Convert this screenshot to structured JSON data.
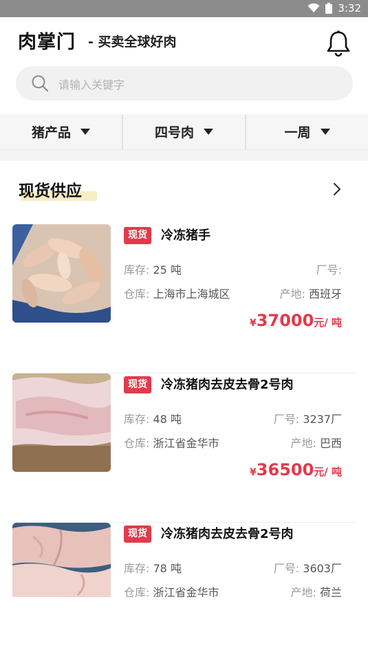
{
  "status": {
    "time": "3:32"
  },
  "header": {
    "title": "肉掌门",
    "subtitle": "- 买卖全球好肉"
  },
  "search": {
    "placeholder": "请输入关键字"
  },
  "filters": [
    {
      "label": "猪产品"
    },
    {
      "label": "四号肉"
    },
    {
      "label": "一周"
    }
  ],
  "section": {
    "title": "现货供应"
  },
  "products": [
    {
      "badge": "现货",
      "name": "冷冻猪手",
      "stock_label": "库存:",
      "stock": "25 吨",
      "factory_label": "厂号:",
      "factory": "",
      "warehouse_label": "仓库:",
      "warehouse": "上海市上海城区",
      "origin_label": "产地:",
      "origin": "西班牙",
      "price_symbol": "¥",
      "price": "37000",
      "price_unit": "元/ 吨"
    },
    {
      "badge": "现货",
      "name": "冷冻猪肉去皮去骨2号肉",
      "stock_label": "库存:",
      "stock": "48 吨",
      "factory_label": "厂号:",
      "factory": "3237厂",
      "warehouse_label": "仓库:",
      "warehouse": "浙江省金华市",
      "origin_label": "产地:",
      "origin": "巴西",
      "price_symbol": "¥",
      "price": "36500",
      "price_unit": "元/ 吨"
    },
    {
      "badge": "现货",
      "name": "冷冻猪肉去皮去骨2号肉",
      "stock_label": "库存:",
      "stock": "78 吨",
      "factory_label": "厂号:",
      "factory": "3603厂",
      "warehouse_label": "仓库:",
      "warehouse": "浙江省金华市",
      "origin_label": "产地:",
      "origin": "荷兰"
    }
  ],
  "colors": {
    "accent": "#e23a4b",
    "highlight": "#f8edc4",
    "statusbar": "#8c8c8c"
  }
}
